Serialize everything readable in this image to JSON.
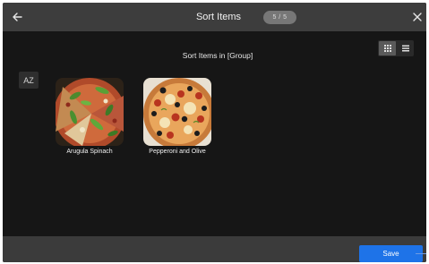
{
  "header": {
    "title": "Sort Items",
    "counter": "5 / 5",
    "back_icon": "arrow-left-icon",
    "close_icon": "close-icon"
  },
  "main": {
    "subtitle": "Sort Items in [Group]",
    "sort_button": "AZ",
    "view_modes": [
      {
        "icon": "grid-view-icon",
        "active": true
      },
      {
        "icon": "list-view-icon",
        "active": false
      }
    ],
    "items": [
      {
        "label": "Arugula Spinach"
      },
      {
        "label": "Pepperoni and Olive"
      }
    ]
  },
  "footer": {
    "save_label": "Save"
  },
  "colors": {
    "background": "#161616",
    "topbar": "#3d3d3d",
    "bottombar": "#3b3b3b",
    "accent": "#1e73e8"
  }
}
